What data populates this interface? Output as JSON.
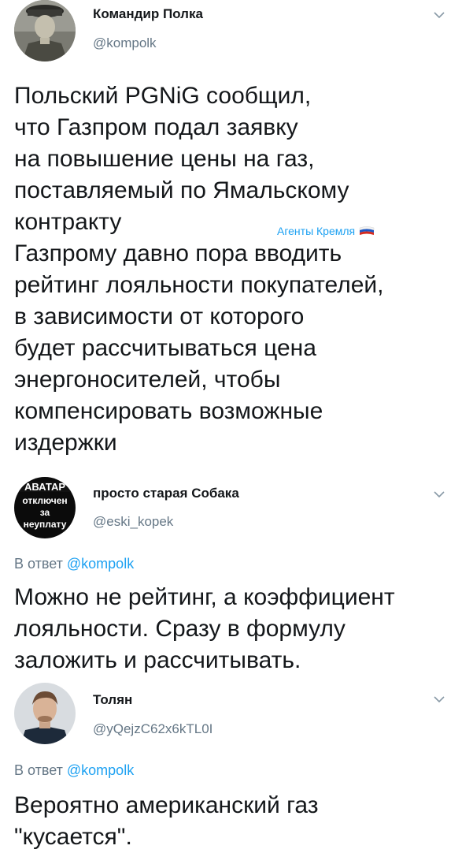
{
  "tweets": [
    {
      "author_name": "Командир Полка",
      "handle": "@kompolk",
      "text": "Польский PGNiG сообщил,\nчто Газпром подал заявку\nна повышение цены на газ,\nпоставляемый по Ямальскому\nконтракту\nГазпрому давно пора вводить\nрейтинг лояльности покупателей,\nв зависимости от которого\nбудет рассчитываться цена\nэнергоносителей, чтобы\nкомпенсировать возможные\nиздержки",
      "badge": "Агенты Кремля",
      "avatar_icon": "military-portrait-avatar"
    },
    {
      "author_name": "просто старая Собака",
      "handle": "@eski_kopek",
      "reply_prefix": "В ответ ",
      "reply_mention": "@kompolk",
      "avatar_lines": [
        "АВАТАР",
        "отключен",
        "за",
        "неуплату"
      ],
      "text": "Можно не рейтинг, а коэффициент\nлояльности. Сразу в формулу\nзаложить и рассчитывать."
    },
    {
      "author_name": "Толян",
      "handle": "@yQejzC62x6kTL0I",
      "reply_prefix": "В ответ ",
      "reply_mention": "@kompolk",
      "text": "Вероятно американский газ\n\"кусается\".",
      "avatar_icon": "man-portrait-avatar"
    }
  ],
  "colors": {
    "text": "#14171a",
    "secondary": "#657786",
    "link": "#1da1f2"
  }
}
